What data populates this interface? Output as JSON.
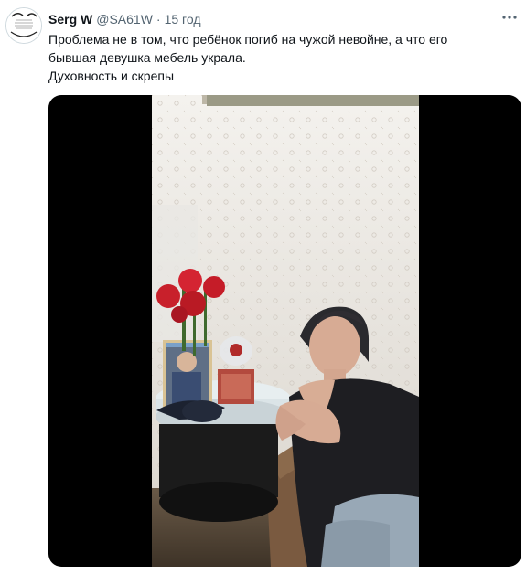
{
  "tweet": {
    "author_name": "Serg W",
    "author_handle": "@SA61W",
    "separator": "·",
    "time": "15 год",
    "text_lines": [
      "Проблема не в том, что ребёнок погиб на чужой невойне, а что его",
      "бывшая девушка мебель украла.",
      "Духовность и скрепы"
    ],
    "avatar_icon": "profile-avatar",
    "more_icon": "more-dots-icon"
  },
  "media": {
    "type": "video-frame",
    "letterbox_color": "#000000"
  }
}
